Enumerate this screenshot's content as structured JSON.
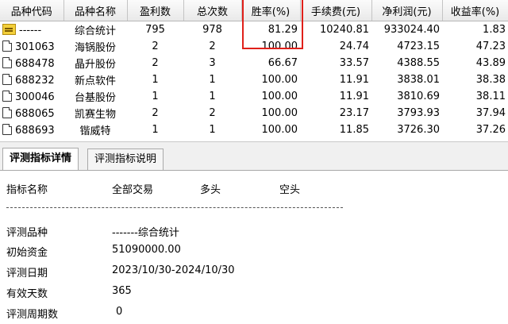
{
  "table": {
    "columns": [
      "品种代码",
      "品种名称",
      "盈利数",
      "总次数",
      "胜率(%)",
      "手续费(元)",
      "净利润(元)",
      "收益率(%)"
    ],
    "rows": [
      {
        "code": "------",
        "name": "综合统计",
        "wins": "795",
        "total": "978",
        "rate": "81.29",
        "fee": "10240.81",
        "profit": "933024.40",
        "yield": "1.83"
      },
      {
        "code": "301063",
        "name": "海锅股份",
        "wins": "2",
        "total": "2",
        "rate": "100.00",
        "fee": "24.74",
        "profit": "4723.15",
        "yield": "47.23"
      },
      {
        "code": "688478",
        "name": "晶升股份",
        "wins": "2",
        "total": "3",
        "rate": "66.67",
        "fee": "33.57",
        "profit": "4388.55",
        "yield": "43.89"
      },
      {
        "code": "688232",
        "name": "新点软件",
        "wins": "1",
        "total": "1",
        "rate": "100.00",
        "fee": "11.91",
        "profit": "3838.01",
        "yield": "38.38"
      },
      {
        "code": "300046",
        "name": "台基股份",
        "wins": "1",
        "total": "1",
        "rate": "100.00",
        "fee": "11.91",
        "profit": "3810.69",
        "yield": "38.11"
      },
      {
        "code": "688065",
        "name": "凯赛生物",
        "wins": "2",
        "total": "2",
        "rate": "100.00",
        "fee": "23.17",
        "profit": "3793.93",
        "yield": "37.94"
      },
      {
        "code": "688693",
        "name": "锴威特",
        "wins": "1",
        "total": "1",
        "rate": "100.00",
        "fee": "11.85",
        "profit": "3726.30",
        "yield": "37.26"
      }
    ],
    "highlight_color": "#e0201a"
  },
  "tabs": [
    "评测指标详情",
    "评测指标说明"
  ],
  "detail": {
    "header": {
      "name_label": "指标名称",
      "all": "全部交易",
      "long": "多头",
      "short": "空头"
    },
    "rows": [
      {
        "label": "评测品种",
        "value": "-------综合统计"
      },
      {
        "label": "初始资金",
        "value": "51090000.00"
      },
      {
        "label": "评测日期",
        "value": "2023/10/30-2024/10/30"
      },
      {
        "label": "有效天数",
        "value": "365"
      },
      {
        "label": "评测周期数",
        "value": "0"
      }
    ]
  }
}
